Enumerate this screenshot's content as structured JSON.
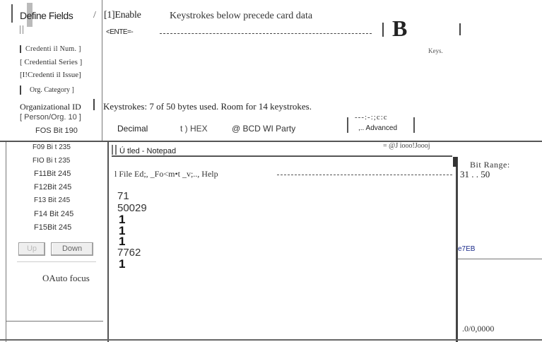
{
  "header": {
    "define_fields": "Define Fields",
    "slash": "/",
    "enable": "[1]Enable",
    "keystrokes_precede": "Keystrokes below precede card data",
    "enter_token": "<ENTE=-",
    "big_b": "B",
    "keys_label": "Keys."
  },
  "fields_left": [
    {
      "label": "Credenti il Num. ]"
    },
    {
      "label": "[ Credential Series ]"
    },
    {
      "label": "[I!Credenti il Issue]"
    },
    {
      "label": "Org. Category ]"
    },
    {
      "label": "Organizational ID"
    },
    {
      "label": "[ Person/Org. 10 ]"
    },
    {
      "label": "FOS Bit 190"
    }
  ],
  "keystrokes_status": "Keystrokes: 7 of 50 bytes used. Room for 14 keystrokes.",
  "format_options": {
    "decimal": "Decimal",
    "hex": "t ) HEX",
    "bcd": "@ BCD WI Party",
    "advanced_glyphs": "---:-:;c:c",
    "advanced": ",.. Advanced"
  },
  "bit_list": [
    "F09 Bi t 235",
    "FIO Bi t 235",
    "F11Bit 245",
    "F12Bit 245",
    "F13 Bit 245",
    "F14 Bit 245",
    "F15Bit 245"
  ],
  "buttons": {
    "up": "Up",
    "down": "Down"
  },
  "auto_focus": "OAuto focus",
  "notepad": {
    "title": "Untitled - Notepad",
    "title_shown": "Ú tled - Notepad",
    "controls": "=  @J iooo!Joooj",
    "menu": "l File  Ed;,  _Fo<m•t  _v;..,  Help",
    "lines": [
      "71",
      "50029",
      "1",
      "1",
      "1",
      "7762",
      "1"
    ]
  },
  "right_panel": {
    "bit_range_label": "Bit Range:",
    "bit_range_value": "31 . . 50",
    "hex_value": "e7EB",
    "bottom_value": ".0/0,0000"
  }
}
